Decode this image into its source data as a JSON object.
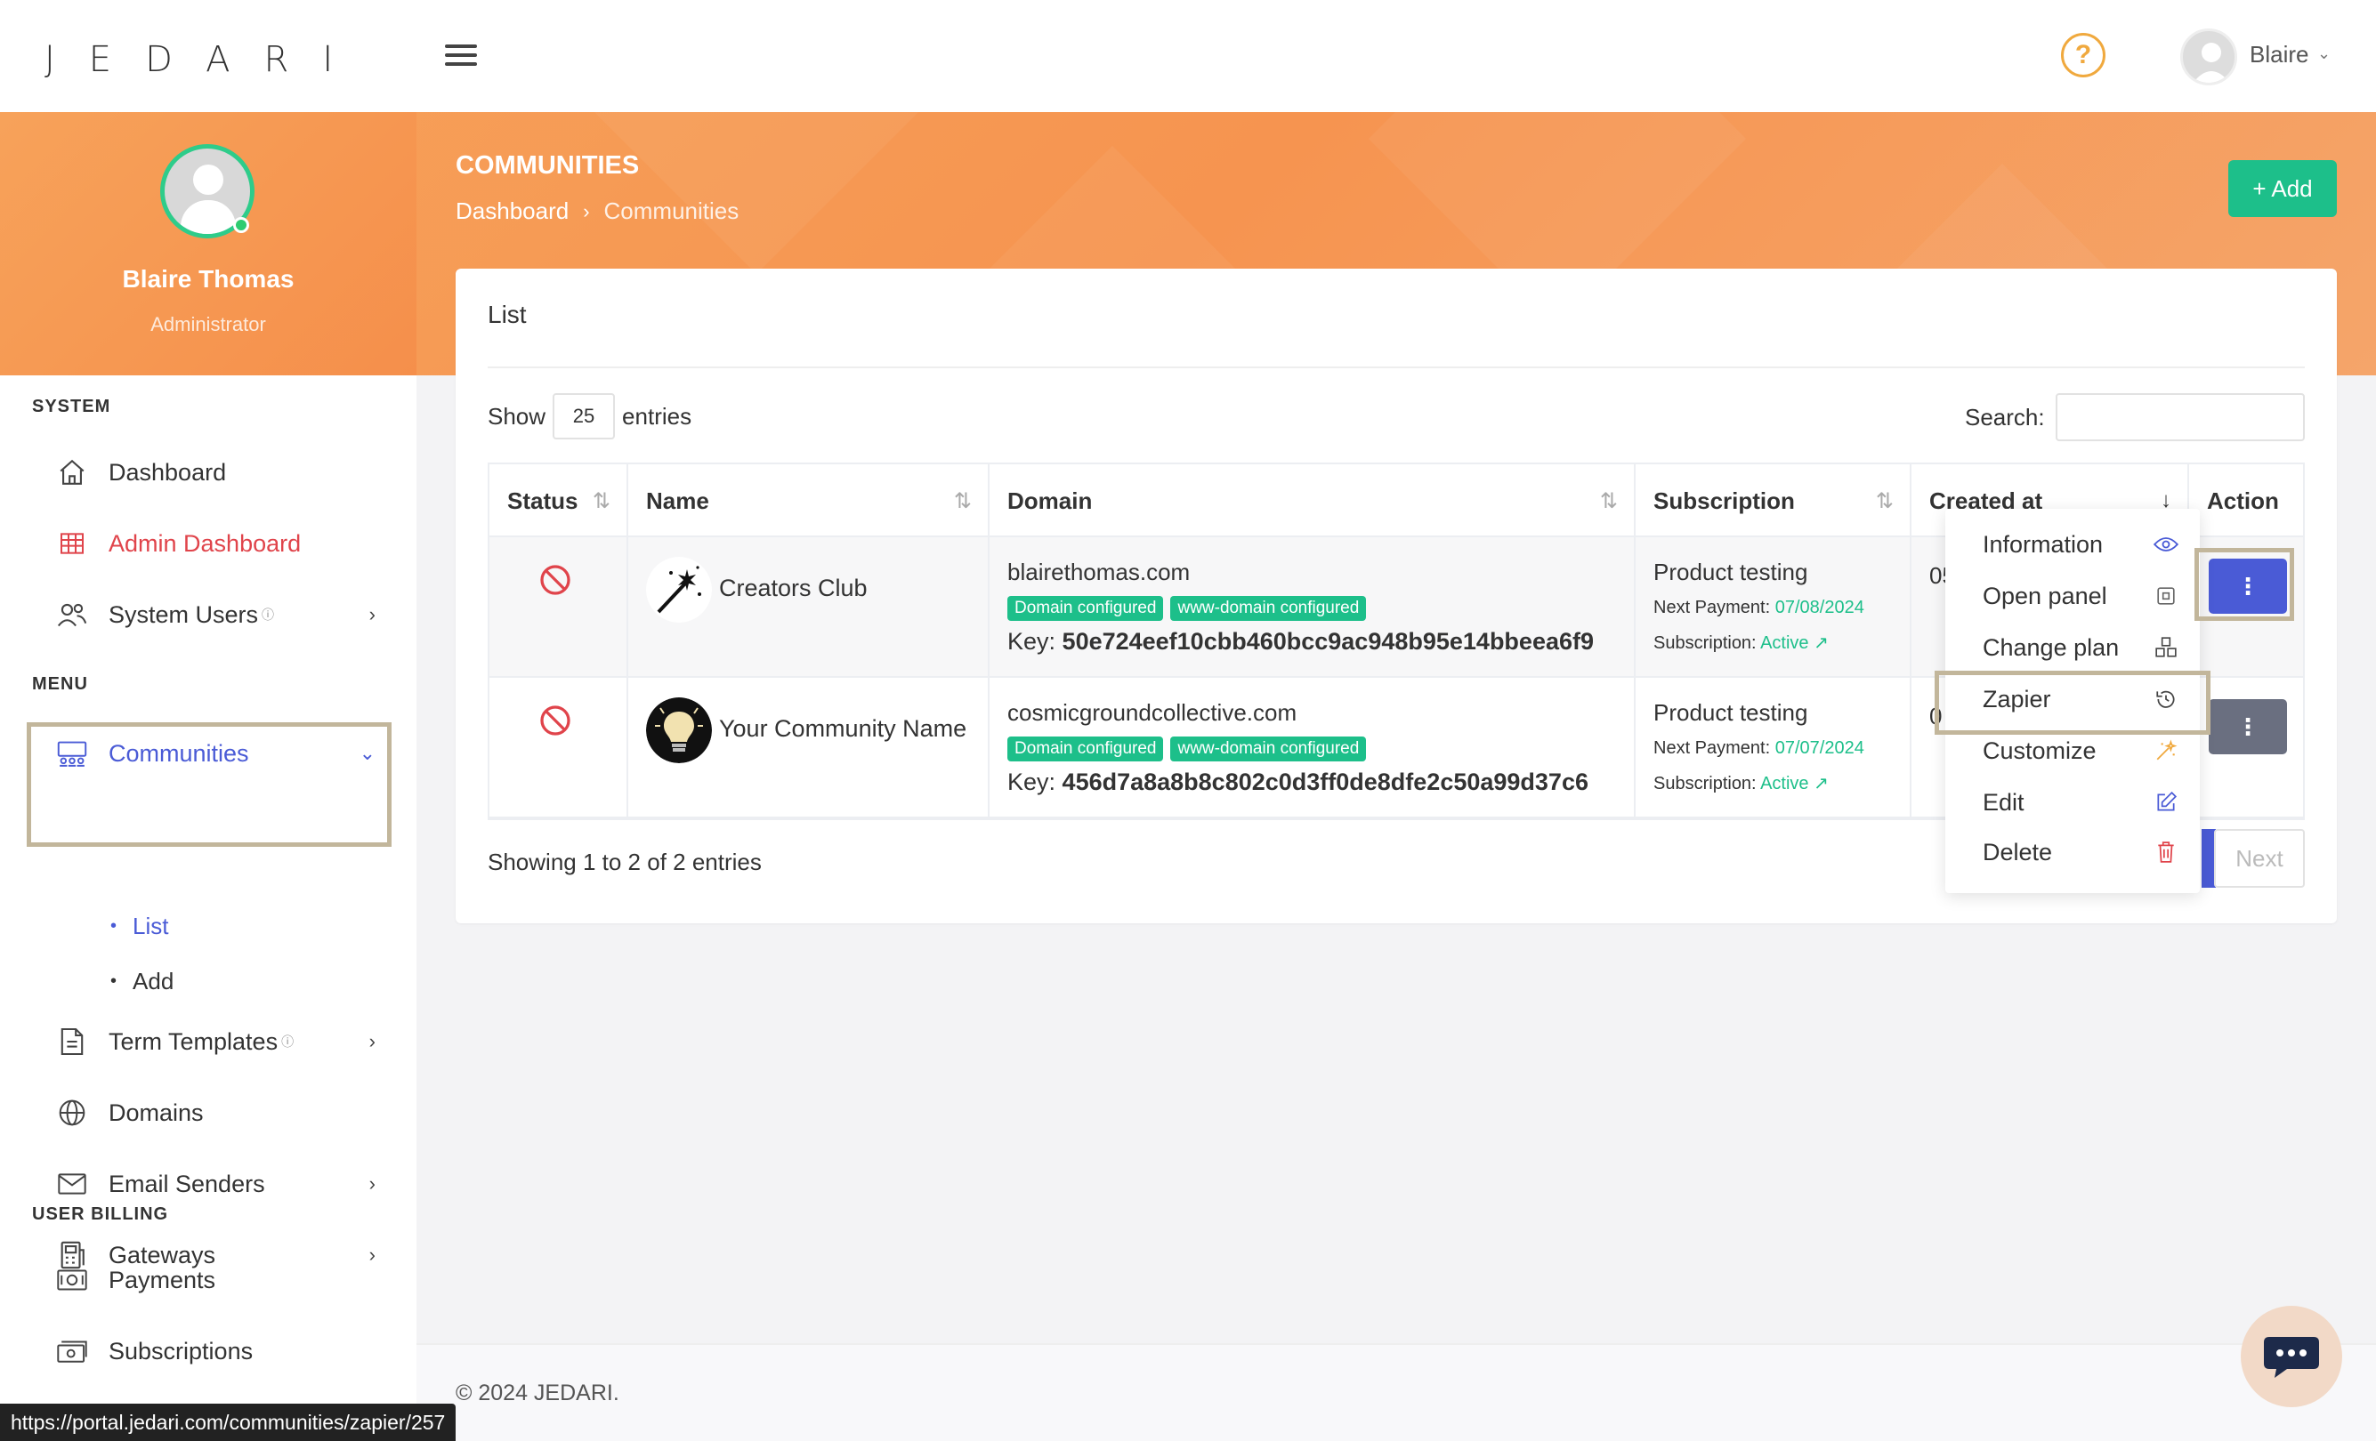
{
  "brand": {
    "logo_text": "JEDARI"
  },
  "topbar": {
    "user_name": "Blaire",
    "help_symbol": "?"
  },
  "profile": {
    "name": "Blaire Thomas",
    "role": "Administrator"
  },
  "sidebar": {
    "sections": {
      "system": "SYSTEM",
      "menu": "MENU",
      "billing": "USER BILLING"
    },
    "items": {
      "dashboard": "Dashboard",
      "admin_dashboard": "Admin Dashboard",
      "system_users": "System Users",
      "communities": "Communities",
      "communities_list": "List",
      "communities_add": "Add",
      "term_templates": "Term Templates",
      "domains": "Domains",
      "email_senders": "Email Senders",
      "gateways": "Gateways",
      "payments": "Payments",
      "subscriptions": "Subscriptions"
    },
    "info_mark": "ⓘ"
  },
  "header": {
    "title": "COMMUNITIES",
    "breadcrumb": [
      "Dashboard",
      "Communities"
    ],
    "add_label": "+ Add"
  },
  "card": {
    "title": "List",
    "show_label": "Show",
    "entries_value": "25",
    "entries_label": "entries",
    "search_label": "Search:",
    "showing": "Showing 1 to 2 of 2 entries",
    "next_label": "Next"
  },
  "table": {
    "columns": [
      "Status",
      "Name",
      "Domain",
      "Subscription",
      "Created at",
      "Action"
    ],
    "rows": [
      {
        "name": "Creators Club",
        "domain": "blairethomas.com",
        "badges": [
          "Domain configured",
          "www-domain configured"
        ],
        "key_label": "Key:",
        "key": "50e724eef10cbb460bcc9ac948b95e14bbeea6f9",
        "plan": "Product testing",
        "next_payment_label": "Next Payment:",
        "next_payment": "07/08/2024",
        "subscription_label": "Subscription:",
        "subscription_status": "Active",
        "created_partial": "05"
      },
      {
        "name": "Your Community Name",
        "domain": "cosmicgroundcollective.com",
        "badges": [
          "Domain configured",
          "www-domain configured"
        ],
        "key_label": "Key:",
        "key": "456d7a8a8b8c802c0d3ff0de8dfe2c50a99d37c6",
        "plan": "Product testing",
        "next_payment_label": "Next Payment:",
        "next_payment": "07/07/2024",
        "subscription_label": "Subscription:",
        "subscription_status": "Active",
        "created_partial": "0"
      }
    ]
  },
  "dropdown": {
    "items": [
      "Information",
      "Open panel",
      "Change plan",
      "Zapier",
      "Customize",
      "Edit",
      "Delete"
    ]
  },
  "footer": {
    "text": "© 2024 JEDARI."
  },
  "status_url": "https://portal.jedari.com/communities/zapier/257",
  "colors": {
    "accent_orange": "#f69450",
    "primary_blue": "#4a5bd6",
    "success_green": "#1dbf8a",
    "danger_red": "#e0444b",
    "highlight_box": "#c2b69b"
  }
}
